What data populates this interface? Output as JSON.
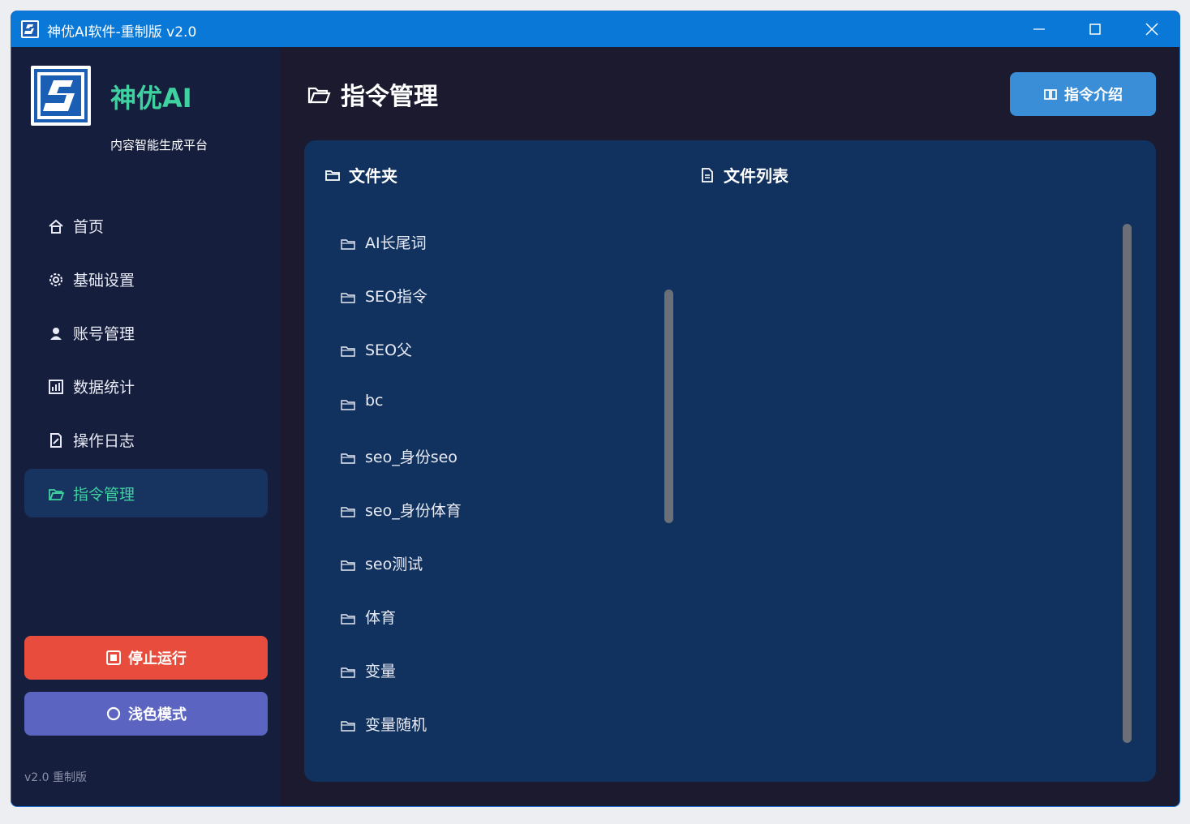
{
  "window": {
    "title": "神优AI软件-重制版 v2.0",
    "icons": [
      "app-logo-icon",
      "minimize-icon",
      "maximize-icon",
      "close-icon"
    ]
  },
  "sidebar": {
    "brand": "神优AI",
    "subtitle": "内容智能生成平台",
    "items": [
      {
        "label": "首页",
        "icon": "home-icon"
      },
      {
        "label": "基础设置",
        "icon": "gear-icon"
      },
      {
        "label": "账号管理",
        "icon": "user-icon"
      },
      {
        "label": "数据统计",
        "icon": "chart-icon"
      },
      {
        "label": "操作日志",
        "icon": "log-icon"
      },
      {
        "label": "指令管理",
        "icon": "folder-open-icon",
        "active": true
      }
    ],
    "stop_label": "停止运行",
    "theme_label": "浅色模式",
    "version": "v2.0 重制版"
  },
  "main": {
    "title": "指令管理",
    "intro_label": "指令介绍",
    "folder_heading": "文件夹",
    "files_heading": "文件列表",
    "folders": [
      "AI长尾词",
      "SEO指令",
      "SEO父",
      "bc",
      "seo_身份seo",
      "seo_身份体育",
      "seo测试",
      "体育",
      "变量",
      "变量随机"
    ]
  },
  "colors": {
    "titlebar": "#0a78d7",
    "background": "#1b1a2e",
    "sidebar": "#151e3c",
    "panel": "#11325e",
    "accent": "#3fd1a0",
    "stop": "#e74c3c",
    "theme": "#5b64c0",
    "intro": "#3a8ed8"
  }
}
